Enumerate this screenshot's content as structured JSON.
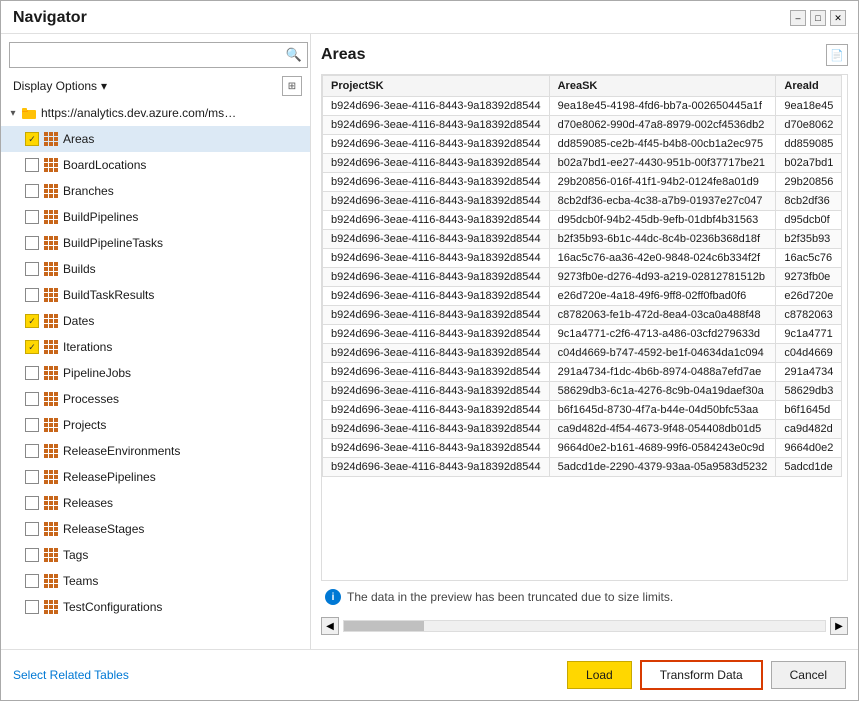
{
  "dialog": {
    "title": "Navigator"
  },
  "title_controls": {
    "minimize": "–",
    "maximize": "□",
    "close": "✕"
  },
  "search": {
    "placeholder": ""
  },
  "display_options": {
    "label": "Display Options",
    "arrow": "▾"
  },
  "tree": {
    "root_url": "https://analytics.dev.azure.com/mseng/Azu...",
    "items": [
      {
        "label": "Areas",
        "checked": true,
        "selected": true
      },
      {
        "label": "BoardLocations",
        "checked": false
      },
      {
        "label": "Branches",
        "checked": false
      },
      {
        "label": "BuildPipelines",
        "checked": false
      },
      {
        "label": "BuildPipelineTasks",
        "checked": false
      },
      {
        "label": "Builds",
        "checked": false
      },
      {
        "label": "BuildTaskResults",
        "checked": false
      },
      {
        "label": "Dates",
        "checked": true
      },
      {
        "label": "Iterations",
        "checked": true
      },
      {
        "label": "PipelineJobs",
        "checked": false
      },
      {
        "label": "Processes",
        "checked": false
      },
      {
        "label": "Projects",
        "checked": false
      },
      {
        "label": "ReleaseEnvironments",
        "checked": false
      },
      {
        "label": "ReleasePipelines",
        "checked": false
      },
      {
        "label": "Releases",
        "checked": false
      },
      {
        "label": "ReleaseStages",
        "checked": false
      },
      {
        "label": "Tags",
        "checked": false
      },
      {
        "label": "Teams",
        "checked": false
      },
      {
        "label": "TestConfigurations",
        "checked": false
      }
    ]
  },
  "right_panel": {
    "title": "Areas",
    "columns": [
      "ProjectSK",
      "AreaSK",
      "AreaId"
    ],
    "rows": [
      {
        "ProjectSK": "b924d696-3eae-4116-8443-9a18392d8544",
        "AreaSK": "9ea18e45-4198-4fd6-bb7a-00265044​5a1f",
        "AreaId": "9ea18e45"
      },
      {
        "ProjectSK": "b924d696-3eae-4116-8443-9a18392d8544",
        "AreaSK": "d70e8062-990d-47a8-8979-002cf4536db2",
        "AreaId": "d70e8062"
      },
      {
        "ProjectSK": "b924d696-3eae-4116-8443-9a18392d8544",
        "AreaSK": "dd859085-ce2b-4f45-b4b8-00cb1a2ec975",
        "AreaId": "dd85908​5"
      },
      {
        "ProjectSK": "b924d696-3eae-4116-8443-9a18392d8544",
        "AreaSK": "b02a7bd1-ee27-4430-951b-00f37717be21",
        "AreaId": "b02a7bd1"
      },
      {
        "ProjectSK": "b924d696-3eae-4116-8443-9a18392d8544",
        "AreaSK": "29b20856-016f-41f1-94b2-0124fe8a01d9",
        "AreaId": "29b20856"
      },
      {
        "ProjectSK": "b924d696-3eae-4116-8443-9a18392d8544",
        "AreaSK": "8cb2df36-ecba-4c38-a7b9-01937e27c047",
        "AreaId": "8cb2df36"
      },
      {
        "ProjectSK": "b924d696-3eae-4116-8443-9a18392d8544",
        "AreaSK": "d95dcb0f-94b2-45db-9efb-01dbf4b31563",
        "AreaId": "d95dcb0f"
      },
      {
        "ProjectSK": "b924d696-3eae-4116-8443-9a18392d8544",
        "AreaSK": "b2f35b93-6b1c-44dc-8c4b-0236b368d18f",
        "AreaId": "b2f35b93"
      },
      {
        "ProjectSK": "b924d696-3eae-4116-8443-9a18392d8544",
        "AreaSK": "16ac5c76-aa36-42e0-9848-024c6b334f2f",
        "AreaId": "16ac5c76"
      },
      {
        "ProjectSK": "b924d696-3eae-4116-8443-9a18392d8544",
        "AreaSK": "9273fb0e-d276-4d93-a219-02812781512b",
        "AreaId": "9273fb0e"
      },
      {
        "ProjectSK": "b924d696-3eae-4116-8443-9a18392d8544",
        "AreaSK": "e26d720e-4a18-49f6-9ff8-02ff0fbad0f6",
        "AreaId": "e26d720e"
      },
      {
        "ProjectSK": "b924d696-3eae-4116-8443-9a18392d8544",
        "AreaSK": "c8782063-fe1b-472d-8ea4-03ca0a488f48",
        "AreaId": "c8782063"
      },
      {
        "ProjectSK": "b924d696-3eae-4116-8443-9a18392d8544",
        "AreaSK": "9c1a4771-c2f6-4713-a486-03cfd279633d",
        "AreaId": "9c1a4771"
      },
      {
        "ProjectSK": "b924d696-3eae-4116-8443-9a18392d8544",
        "AreaSK": "c04d4669-b747-4592-be1f-04634da1c094",
        "AreaId": "c04d4669"
      },
      {
        "ProjectSK": "b924d696-3eae-4116-8443-9a18392d8544",
        "AreaSK": "291a4734-f1dc-4b6b-8974-0488a7efd7ae",
        "AreaId": "291a4734"
      },
      {
        "ProjectSK": "b924d696-3eae-4116-8443-9a18392d8544",
        "AreaSK": "58629db3-6c1a-4276-8c9b-04a19daef30a",
        "AreaId": "58629db3"
      },
      {
        "ProjectSK": "b924d696-3eae-4116-8443-9a18392d8544",
        "AreaSK": "b6f1645d-8730-4f7a-b44e-04d50bfc53aa",
        "AreaId": "b6f1645d"
      },
      {
        "ProjectSK": "b924d696-3eae-4116-8443-9a18392d8544",
        "AreaSK": "ca9d482d-4f54-4673-9f48-054408db01d5",
        "AreaId": "ca9d482d"
      },
      {
        "ProjectSK": "b924d696-3eae-4116-8443-9a18392d8544",
        "AreaSK": "9664d0e2-b161-4689-99f6-0584243e0c9d",
        "AreaId": "9664d0e2"
      },
      {
        "ProjectSK": "b924d696-3eae-4116-8443-9a18392d8544",
        "AreaSK": "5adcd1de-2290-4379-93aa-05a9583d5232",
        "AreaId": "5adcd1de"
      }
    ],
    "truncate_notice": "The data in the preview has been truncated due to size limits."
  },
  "footer": {
    "select_related": "Select Related Tables",
    "load_btn": "Load",
    "transform_btn": "Transform Data",
    "cancel_btn": "Cancel"
  }
}
